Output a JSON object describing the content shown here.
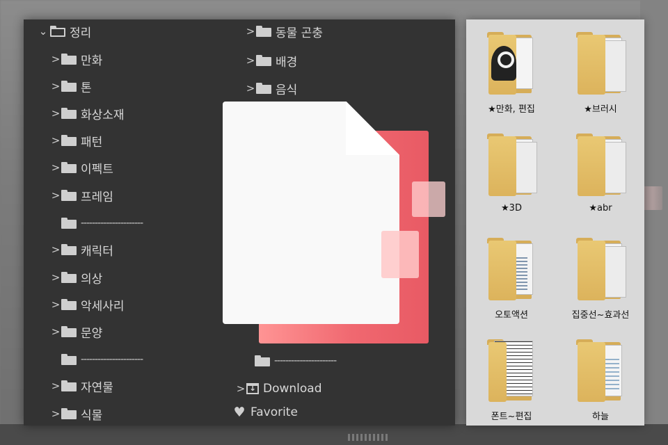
{
  "tree_panel": {
    "left_column": [
      {
        "label": "정리",
        "expanded": true,
        "open_folder": true
      },
      {
        "label": "만화"
      },
      {
        "label": "톤"
      },
      {
        "label": "화상소재"
      },
      {
        "label": "패턴"
      },
      {
        "label": "이펙트"
      },
      {
        "label": "프레임"
      },
      {
        "label": "----------------------",
        "separator": true
      },
      {
        "label": "캐릭터"
      },
      {
        "label": "의상"
      },
      {
        "label": "악세사리"
      },
      {
        "label": "문양"
      },
      {
        "label": "----------------------",
        "separator": true
      },
      {
        "label": "자연물"
      },
      {
        "label": "식물"
      }
    ],
    "right_column": [
      {
        "label": "동물 곤충"
      },
      {
        "label": "배경"
      },
      {
        "label": "음식"
      },
      {
        "label": "---------------------",
        "separator": true
      },
      {
        "label": "----------------------",
        "separator": true
      },
      {
        "label": "Download"
      },
      {
        "label": "Favorite"
      }
    ]
  },
  "grid_panel": {
    "folders": [
      {
        "label": "★만화, 편집"
      },
      {
        "label": "★브러시"
      },
      {
        "label": "★3D"
      },
      {
        "label": "★abr"
      },
      {
        "label": "오토액션"
      },
      {
        "label": "집중선~효과선"
      },
      {
        "label": "폰트~편집"
      },
      {
        "label": "하늘"
      }
    ]
  },
  "colors": {
    "tree_bg": "#333333",
    "grid_bg": "#d9d9d9",
    "folder_yellow": "#dcb35c",
    "file_red": "#f06870"
  },
  "icons": [
    "folder-icon",
    "open-folder-icon",
    "chevron-right-icon",
    "chevron-down-icon",
    "download-icon",
    "heart-icon",
    "file-icon"
  ]
}
